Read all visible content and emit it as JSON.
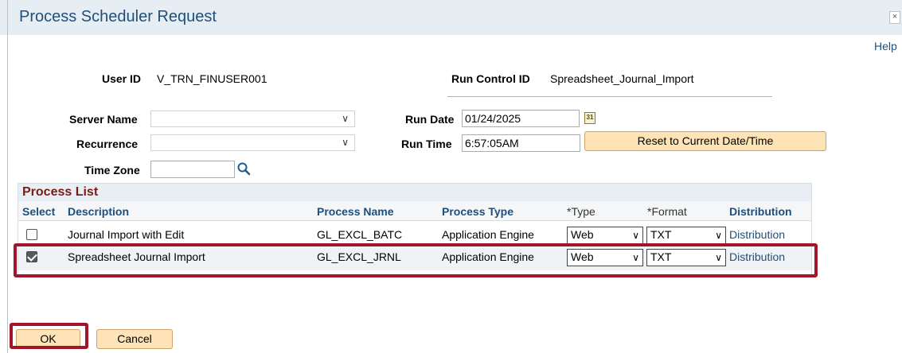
{
  "window": {
    "title": "Process Scheduler Request",
    "close_label": "×",
    "help_label": "Help"
  },
  "ids": {
    "user_id_label": "User ID",
    "user_id_value": "V_TRN_FINUSER001",
    "run_control_label": "Run Control ID",
    "run_control_value": "Spreadsheet_Journal_Import"
  },
  "fields": {
    "server_name_label": "Server Name",
    "server_name_value": "",
    "recurrence_label": "Recurrence",
    "recurrence_value": "",
    "time_zone_label": "Time Zone",
    "time_zone_value": "",
    "run_date_label": "Run Date",
    "run_date_value": "01/24/2025",
    "run_time_label": "Run Time",
    "run_time_value": "6:57:05AM",
    "calendar_icon_text": "31",
    "reset_button_label": "Reset to Current Date/Time"
  },
  "process_list": {
    "title": "Process List",
    "headers": {
      "select": "Select",
      "description": "Description",
      "process_name": "Process Name",
      "process_type": "Process Type",
      "type": "*Type",
      "format": "*Format",
      "distribution": "Distribution"
    },
    "rows": [
      {
        "selected": false,
        "description": "Journal Import with Edit",
        "process_name": "GL_EXCL_BATC",
        "process_type": "Application Engine",
        "type": "Web",
        "format": "TXT",
        "distribution": "Distribution"
      },
      {
        "selected": true,
        "description": "Spreadsheet Journal Import",
        "process_name": "GL_EXCL_JRNL",
        "process_type": "Application Engine",
        "type": "Web",
        "format": "TXT",
        "distribution": "Distribution"
      }
    ]
  },
  "buttons": {
    "ok_label": "OK",
    "cancel_label": "Cancel"
  },
  "colors": {
    "accent": "#1f4f7a",
    "grid_title": "#7a1b14",
    "button_bg": "#fde3b5",
    "highlight": "#a3152a"
  }
}
